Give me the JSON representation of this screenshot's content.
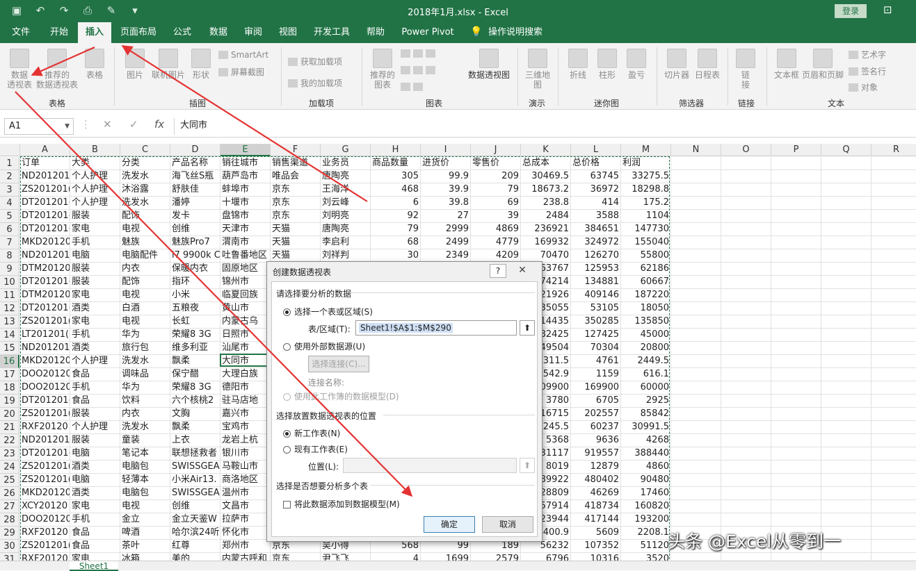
{
  "window": {
    "title": "2018年1月.xlsx  -  Excel",
    "login": "登录"
  },
  "tabs": [
    "文件",
    "开始",
    "插入",
    "页面布局",
    "公式",
    "数据",
    "审阅",
    "视图",
    "开发工具",
    "帮助",
    "Power Pivot",
    "操作说明搜索"
  ],
  "active_tab": "插入",
  "ribbon": {
    "groups": [
      "表格",
      "插图",
      "加载项",
      "图表",
      "演示",
      "迷你图",
      "筛选器",
      "链接",
      "文本"
    ],
    "buttons": {
      "pivot": "数据\n透视表",
      "recommended_pivot": "推荐的\n数据透视表",
      "table": "表格",
      "picture": "图片",
      "online_picture": "联机图片",
      "shapes": "形状",
      "smartart": "SmartArt",
      "screenshot": "屏幕截图",
      "get_addins": "获取加载项",
      "my_addins": "我的加载项",
      "recommended_charts": "推荐的\n图表",
      "pivot_chart": "数据透视图",
      "map3d": "三维地\n图",
      "line": "折线",
      "column": "柱形",
      "winloss": "盈亏",
      "slicer": "切片器",
      "timeline": "日程表",
      "link": "链\n接",
      "textbox": "文本框",
      "header_footer": "页眉和页脚",
      "wordart": "艺术字",
      "signature": "签名行",
      "object": "对象"
    }
  },
  "formula_bar": {
    "name_box": "A1",
    "cancel": "✕",
    "enter": "✓",
    "fx": "fx",
    "value": "大同市"
  },
  "columns": [
    "A",
    "B",
    "C",
    "D",
    "E",
    "F",
    "G",
    "H",
    "I",
    "J",
    "K",
    "L",
    "M",
    "N",
    "O",
    "P",
    "Q",
    "R"
  ],
  "rows": [
    [
      "订单",
      "大类",
      "分类",
      "产品名称",
      "销往城市",
      "销售渠道",
      "业务员",
      "商品数量",
      "进货价",
      "零售价",
      "总成本",
      "总价格",
      "利润"
    ],
    [
      "ND201201",
      "个人护理",
      "洗发水",
      "海飞丝S瓶",
      "葫芦岛市",
      "唯品会",
      "唐陶亮",
      "305",
      "99.9",
      "209",
      "30469.5",
      "63745",
      "33275.5"
    ],
    [
      "ZS201201(",
      "个人护理",
      "沐浴露",
      "舒肤佳",
      "蚌埠市",
      "京东",
      "王海洋",
      "468",
      "39.9",
      "79",
      "18673.2",
      "36972",
      "18298.8"
    ],
    [
      "DT201201(",
      "个人护理",
      "洗发水",
      "潘婷",
      "十堰市",
      "京东",
      "刘云峰",
      "6",
      "39.8",
      "69",
      "238.8",
      "414",
      "175.2"
    ],
    [
      "DT201201(",
      "服装",
      "配饰",
      "发卡",
      "盘锦市",
      "京东",
      "刘明亮",
      "92",
      "27",
      "39",
      "2484",
      "3588",
      "1104"
    ],
    [
      "DT201201(",
      "家电",
      "电视",
      "创维",
      "天津市",
      "天猫",
      "唐陶亮",
      "79",
      "2999",
      "4869",
      "236921",
      "384651",
      "147730"
    ],
    [
      "MKD20120",
      "手机",
      "魅族",
      "魅族Pro7",
      "渭南市",
      "天猫",
      "李启利",
      "68",
      "2499",
      "4779",
      "169932",
      "324972",
      "155040"
    ],
    [
      "ND201201",
      "电脑",
      "电脑配件",
      "i7 9900k C",
      "吐鲁番地区",
      "天猫",
      "刘祥判",
      "30",
      "2349",
      "4209",
      "70470",
      "126270",
      "55800"
    ],
    [
      "DTM20120",
      "服装",
      "内衣",
      "保暖内衣",
      "固原地区",
      "",
      "",
      "",
      "",
      "",
      "63767",
      "125953",
      "62186"
    ],
    [
      "DT201201(",
      "服装",
      "配饰",
      "指环",
      "锦州市",
      "",
      "",
      "",
      "",
      "",
      "74214",
      "134881",
      "60667"
    ],
    [
      "DTM20120",
      "家电",
      "电视",
      "小米",
      "临夏回族",
      "",
      "",
      "",
      "",
      "",
      "21926",
      "409146",
      "187220"
    ],
    [
      "DT201201(",
      "酒类",
      "白酒",
      "五粮夜",
      "黄山市",
      "",
      "",
      "",
      "",
      "",
      "35055",
      "53105",
      "18050"
    ],
    [
      "ZS201201(",
      "家电",
      "电视",
      "长虹",
      "内蒙古乌",
      "",
      "",
      "",
      "",
      "",
      "14435",
      "350285",
      "135850"
    ],
    [
      "LT201201(",
      "手机",
      "华为",
      "荣耀8 3G",
      "日照市",
      "",
      "",
      "",
      "",
      "",
      "82425",
      "127425",
      "45000"
    ],
    [
      "ND201201",
      "酒类",
      "旅行包",
      "维多利亚",
      "汕尾市",
      "",
      "",
      "",
      "",
      "",
      "49504",
      "70304",
      "20800"
    ],
    [
      "MKD20120",
      "个人护理",
      "洗发水",
      "飘柔",
      "大同市",
      "",
      "",
      "",
      "",
      "",
      "2311.5",
      "4761",
      "2449.5"
    ],
    [
      "DOO20120",
      "食品",
      "调味品",
      "保宁醋",
      "大理白族",
      "",
      "",
      "",
      "",
      "",
      "542.9",
      "1159",
      "616.1"
    ],
    [
      "DOO20120",
      "手机",
      "华为",
      "荣耀8 3G",
      "德阳市",
      "",
      "",
      "",
      "",
      "",
      "109900",
      "169900",
      "60000"
    ],
    [
      "DT201201(",
      "食品",
      "饮料",
      "六个核桃2",
      "驻马店地",
      "",
      "",
      "",
      "",
      "",
      "3780",
      "6705",
      "2925"
    ],
    [
      "ZS201201(",
      "服装",
      "内衣",
      "文胸",
      "嘉兴市",
      "",
      "",
      "",
      "",
      "",
      "116715",
      "202557",
      "85842"
    ],
    [
      "RXF20120",
      "个人护理",
      "洗发水",
      "飘柔",
      "宝鸡市",
      "",
      "",
      "",
      "",
      "",
      "29245.5",
      "60237",
      "30991.5"
    ],
    [
      "ND201201",
      "服装",
      "童装",
      "上衣",
      "龙岩上杭",
      "",
      "",
      "",
      "",
      "",
      "5368",
      "9636",
      "4268"
    ],
    [
      "DT201201(",
      "电脑",
      "笔记本",
      "联想拯救者",
      "银川市",
      "",
      "",
      "",
      "",
      "",
      "531117",
      "919557",
      "388440"
    ],
    [
      "ZS201201(",
      "酒类",
      "电脑包",
      "SWISSGEA",
      "马鞍山市",
      "",
      "",
      "",
      "",
      "",
      "8019",
      "12879",
      "4860"
    ],
    [
      "ZS201201(",
      "电脑",
      "轻薄本",
      "小米Air13.",
      "商洛地区",
      "",
      "",
      "",
      "",
      "",
      "389922",
      "480402",
      "90480"
    ],
    [
      "MKD20120",
      "酒类",
      "电脑包",
      "SWISSGEA",
      "温州市",
      "",
      "",
      "",
      "",
      "",
      "28809",
      "46269",
      "17460"
    ],
    [
      "XCY20120",
      "家电",
      "电视",
      "创维",
      "文昌市",
      "",
      "",
      "",
      "",
      "",
      "257914",
      "418734",
      "160820"
    ],
    [
      "DOO20120",
      "手机",
      "金立",
      "金立天鉴W",
      "拉萨市",
      "",
      "",
      "",
      "",
      "",
      "223944",
      "417144",
      "193200"
    ],
    [
      "RXF20120",
      "食品",
      "啤酒",
      "哈尔滨24听",
      "怀化市",
      "",
      "",
      "",
      "",
      "",
      "3400.9",
      "5609",
      "2208.1"
    ],
    [
      "ZS201201(",
      "食品",
      "茶叶",
      "红尊",
      "郑州市",
      "京东",
      "吴小得",
      "568",
      "99",
      "189",
      "56232",
      "107352",
      "51120"
    ],
    [
      "RXF20120",
      "家电",
      "冰箱",
      "美的",
      "内蒙古呼和",
      "京东",
      "尹飞飞",
      "4",
      "1699",
      "2579",
      "6796",
      "10316",
      "3520"
    ]
  ],
  "sheet_tab": "Sheet1",
  "dialog": {
    "title": "创建数据透视表",
    "help": "?",
    "close": "✕",
    "section1": "请选择要分析的数据",
    "opt_range": "选择一个表或区域(S)",
    "range_label": "表/区域(T):",
    "range_value": "Sheet1!$A$1:$M$290",
    "collapse": "⬆",
    "opt_external": "使用外部数据源(U)",
    "choose_conn": "选择连接(C)...",
    "conn_name": "连接名称:",
    "opt_model": "使用此工作簿的数据模型(D)",
    "section2": "选择放置数据透视表的位置",
    "opt_new": "新工作表(N)",
    "opt_existing": "现有工作表(E)",
    "location_label": "位置(L):",
    "location_value": "",
    "section3": "选择是否想要分析多个表",
    "add_model": "将此数据添加到数据模型(M)",
    "ok": "确定",
    "cancel": "取消"
  },
  "watermark": "头条 @Excel从零到一",
  "colors": {
    "excel_green": "#217346",
    "arrow_red": "#e53333"
  }
}
